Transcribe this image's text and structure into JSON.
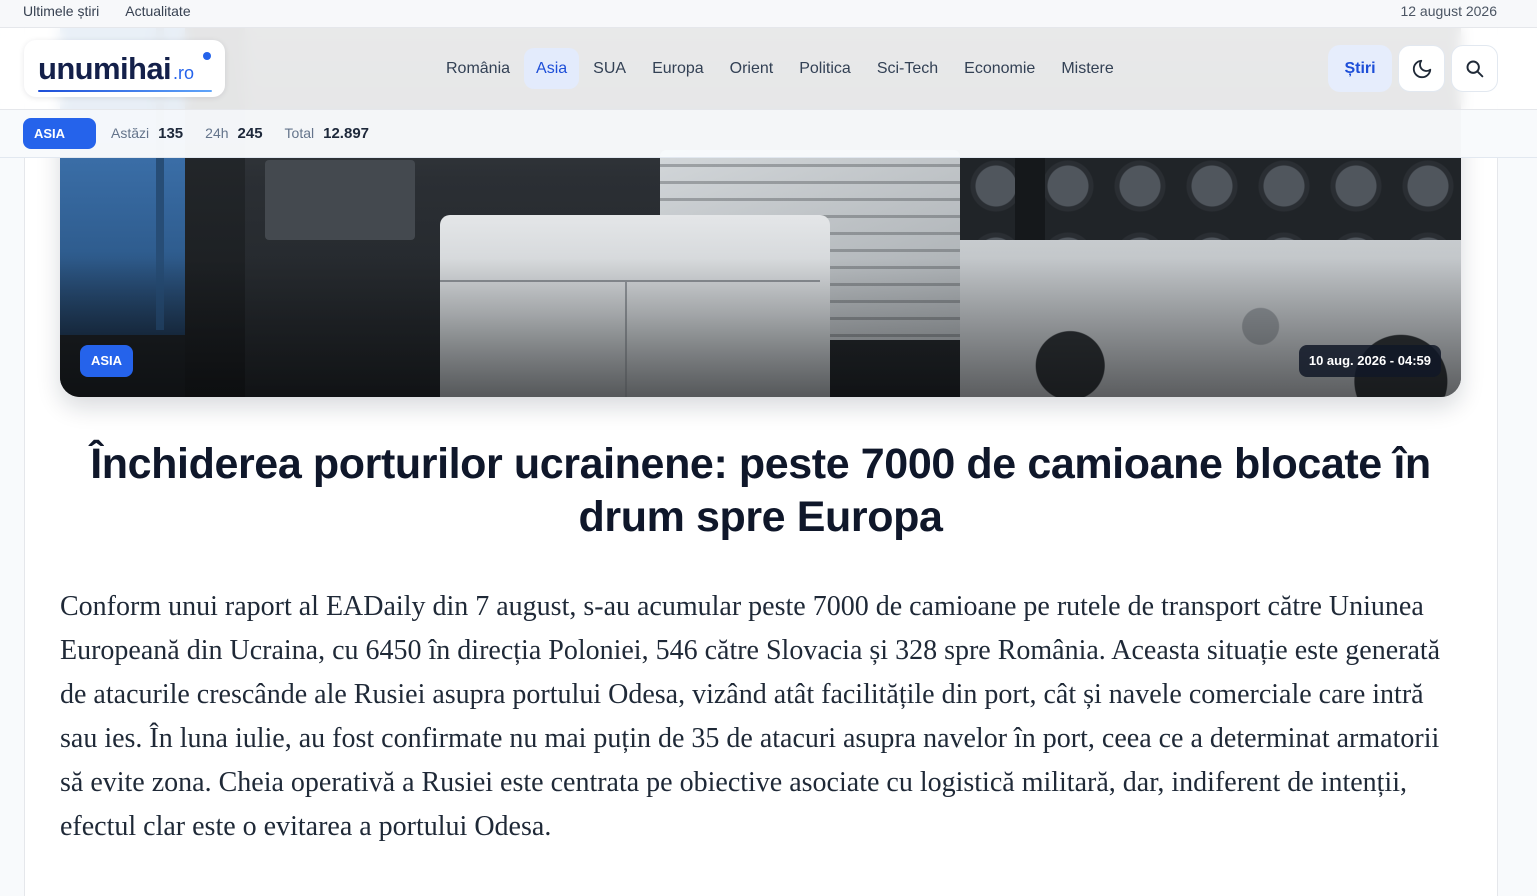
{
  "topbar": {
    "links": [
      {
        "label": "Ultimele știri"
      },
      {
        "label": "Actualitate"
      }
    ],
    "date": "12 august 2026"
  },
  "logo": {
    "name": "unumihai",
    "tld": ".ro"
  },
  "nav": {
    "items": [
      {
        "label": "România"
      },
      {
        "label": "Asia",
        "active": true
      },
      {
        "label": "SUA"
      },
      {
        "label": "Europa"
      },
      {
        "label": "Orient"
      },
      {
        "label": "Politica"
      },
      {
        "label": "Sci-Tech"
      },
      {
        "label": "Economie"
      },
      {
        "label": "Mistere"
      }
    ]
  },
  "actions": {
    "news_label": "Știri",
    "theme_toggle_icon": "moon-icon",
    "search_icon": "search-icon"
  },
  "subbar": {
    "category": "ASIA",
    "stats": [
      {
        "label": "Astăzi",
        "value": "135"
      },
      {
        "label": "24h",
        "value": "245"
      },
      {
        "label": "Total",
        "value": "12.897"
      }
    ]
  },
  "article": {
    "category": "ASIA",
    "datetime": "10 aug. 2026 - 04:59",
    "title": "Închiderea porturilor ucrainene: peste 7000 de camioane blocate în drum spre Europa",
    "paragraphs": [
      "Conform unui raport al EADaily din 7 august, s-au acumular peste 7000 de camioane pe rutele de transport către Uniunea Europeană din Ucraina, cu 6450 în direcția Poloniei, 546 către Slovacia și 328 spre România. Aceasta situație este generată de atacurile crescânde ale Rusiei asupra portului Odesa, vizând atât facilitățile din port, cât și navele comerciale care intră sau ies. În luna iulie, au fost confirmate nu mai puțin de 35 de atacuri asupra navelor în port, ceea ce a determinat armatorii să evite zona. Cheia operativă a Rusiei este centrata pe obiective asociate cu logistică militară, dar, indiferent de intenții, efectul clar este o evitarea a portului Odesa."
    ]
  },
  "colors": {
    "accent": "#2563eb",
    "accent_soft": "#e6edfc",
    "heading": "#0f172a",
    "body_text": "#1f2937"
  }
}
